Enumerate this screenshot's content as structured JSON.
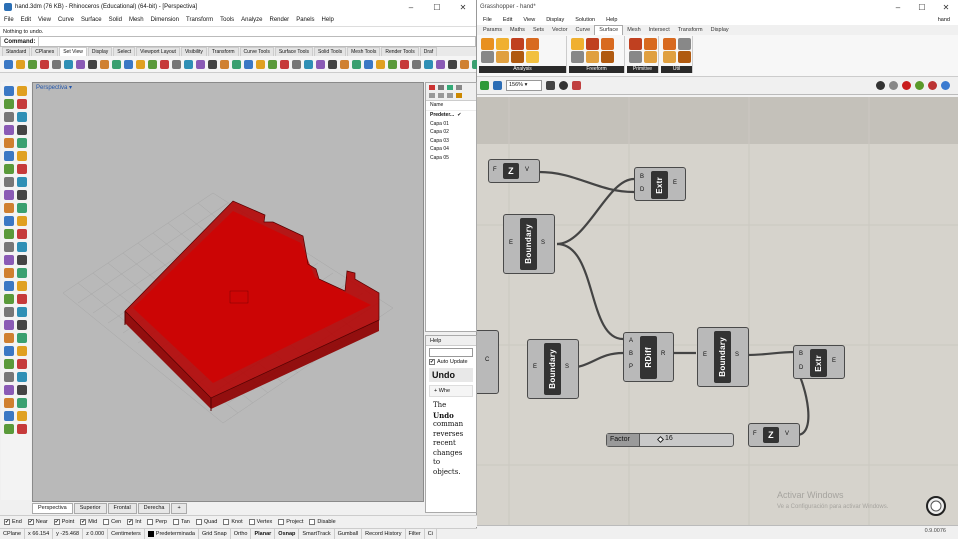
{
  "rhino": {
    "title": "hand.3dm (76 KB) - Rhinoceros (Educational) (64-bit) - [Perspectiva]",
    "menu": [
      "File",
      "Edit",
      "View",
      "Curve",
      "Surface",
      "Solid",
      "Mesh",
      "Dimension",
      "Transform",
      "Tools",
      "Analyze",
      "Render",
      "Panels",
      "Help"
    ],
    "history": "Nothing to undo.",
    "command_label": "Command:",
    "toolbar_tabs": [
      "Standard",
      "CPlanes",
      "Set View",
      "Display",
      "Select",
      "Viewport Layout",
      "Visibility",
      "Transform",
      "Curve Tools",
      "Surface Tools",
      "Solid Tools",
      "Mesh Tools",
      "Render Tools",
      "Draf"
    ],
    "active_tab": "Set View",
    "viewport_label": "Perspectiva",
    "view_tabs": [
      "Perspectiva",
      "Superior",
      "Frontal",
      "Derecha"
    ],
    "view_add": "+",
    "layers": {
      "column": "Name",
      "rows": [
        "Predeter...",
        "Capa 01",
        "Capa 02",
        "Capa 03",
        "Capa 04",
        "Capa 05"
      ],
      "check": "✔"
    },
    "help": {
      "tab": "Help",
      "auto_update": "Auto Update",
      "title": "Undo",
      "when_button": "+ Whe",
      "text_lines": [
        "The",
        "Undo",
        "comman",
        "reverses",
        "recent",
        "changes",
        "to",
        "objects."
      ]
    },
    "osnaps": [
      {
        "label": "End",
        "checked": true
      },
      {
        "label": "Near",
        "checked": true
      },
      {
        "label": "Point",
        "checked": true
      },
      {
        "label": "Mid",
        "checked": true
      },
      {
        "label": "Cen",
        "checked": false
      },
      {
        "label": "Int",
        "checked": true
      },
      {
        "label": "Perp",
        "checked": false
      },
      {
        "label": "Tan",
        "checked": false
      },
      {
        "label": "Quad",
        "checked": false
      },
      {
        "label": "Knot",
        "checked": false
      },
      {
        "label": "Vertex",
        "checked": false
      },
      {
        "label": "Project",
        "checked": false
      },
      {
        "label": "Disable",
        "checked": false
      }
    ],
    "status": {
      "cplane": "CPlane",
      "x": "x 66.154",
      "y": "y -25.468",
      "z": "z 0.000",
      "units": "Centimeters",
      "layer": "Predeterminada",
      "toggles": [
        "Grid Snap",
        "Ortho",
        "Planar",
        "Osnap",
        "SmartTrack",
        "Gumball",
        "Record History",
        "Filter"
      ],
      "active_toggles": [
        "Planar",
        "Osnap"
      ],
      "extra": "Ci"
    }
  },
  "grasshopper": {
    "title": "Grasshopper - hand*",
    "menu": [
      "File",
      "Edit",
      "View",
      "Display",
      "Solution",
      "Help"
    ],
    "doc_name": "hand",
    "tabs": [
      "Params",
      "Maths",
      "Sets",
      "Vector",
      "Curve",
      "Surface",
      "Mesh",
      "Intersect",
      "Transform",
      "Display"
    ],
    "active_tab": "Surface",
    "groups": [
      "Analysis",
      "Freeform",
      "Primitive",
      "Util"
    ],
    "zoom": "156%",
    "components": {
      "vector_z": {
        "label": "Z",
        "in": "F",
        "out": "V"
      },
      "extr_top": {
        "label": "Extr",
        "in": [
          "B",
          "D"
        ],
        "out": "E"
      },
      "boundary_1": {
        "label": "Boundary",
        "in": "E",
        "out": "S"
      },
      "boundary_2": {
        "label": "Boundary",
        "in": "E",
        "out": "S"
      },
      "rdiff": {
        "label": "RDiff",
        "in": [
          "A",
          "B",
          "P"
        ],
        "out": "R"
      },
      "boundary_3": {
        "label": "Boundary",
        "in": "E",
        "out": "S"
      },
      "extr_bottom": {
        "label": "Extr",
        "in": [
          "B",
          "D"
        ],
        "out": "E"
      },
      "partial_left": {
        "out": "C"
      },
      "vector_z2": {
        "label": "Z",
        "in": "F",
        "out": "V"
      },
      "slider": {
        "name": "Factor",
        "value": 16
      }
    },
    "watermark_title": "Activar Windows",
    "watermark_sub": "Ve a Configuración para activar Windows.",
    "version": "0.9.0076"
  }
}
